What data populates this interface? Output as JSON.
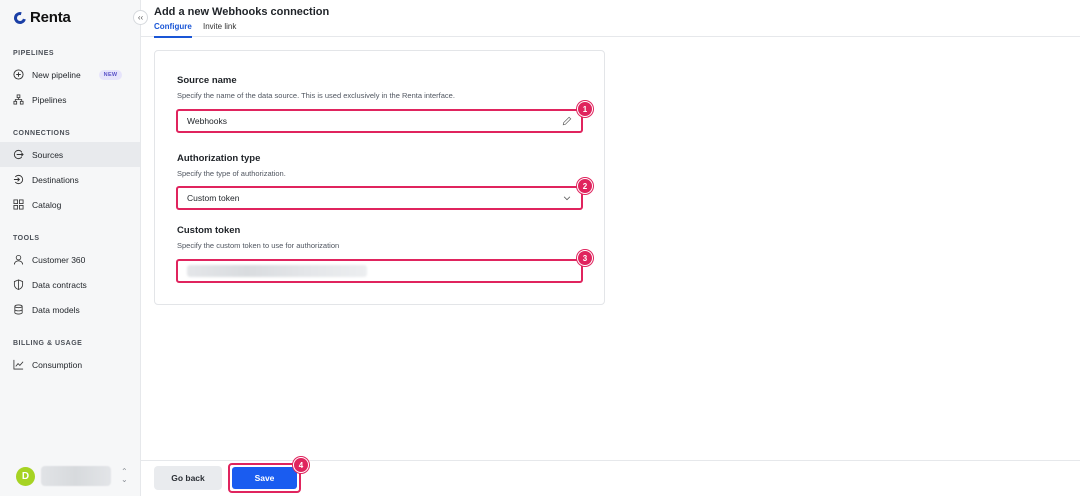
{
  "brand": {
    "name": "Renta"
  },
  "sidebar": {
    "sections": [
      {
        "title": "PIPELINES",
        "items": [
          {
            "label": "New pipeline",
            "icon": "plus-circle-icon",
            "badge": "NEW"
          },
          {
            "label": "Pipelines",
            "icon": "hierarchy-icon"
          }
        ]
      },
      {
        "title": "CONNECTIONS",
        "items": [
          {
            "label": "Sources",
            "icon": "source-icon",
            "active": true
          },
          {
            "label": "Destinations",
            "icon": "destination-icon"
          },
          {
            "label": "Catalog",
            "icon": "grid-icon"
          }
        ]
      },
      {
        "title": "TOOLS",
        "items": [
          {
            "label": "Customer 360",
            "icon": "user-icon"
          },
          {
            "label": "Data contracts",
            "icon": "shield-icon"
          },
          {
            "label": "Data models",
            "icon": "database-icon"
          }
        ]
      },
      {
        "title": "BILLING & USAGE",
        "items": [
          {
            "label": "Consumption",
            "icon": "chart-icon"
          }
        ]
      }
    ],
    "account": {
      "avatar_letter": "D"
    }
  },
  "header": {
    "title": "Add a new Webhooks connection",
    "tabs": [
      {
        "label": "Configure",
        "active": true
      },
      {
        "label": "Invite link"
      }
    ]
  },
  "form": {
    "source_name": {
      "label": "Source name",
      "help": "Specify the name of the data source. This is used exclusively in the Renta interface.",
      "value": "Webhooks",
      "marker": "1"
    },
    "authorization_type": {
      "label": "Authorization type",
      "help": "Specify the type of authorization.",
      "value": "Custom token",
      "marker": "2"
    },
    "custom_token": {
      "label": "Custom token",
      "help": "Specify the custom token to use for authorization",
      "marker": "3"
    }
  },
  "footer": {
    "back_label": "Go back",
    "save_label": "Save",
    "save_marker": "4"
  },
  "colors": {
    "accent": "#1a5cf0",
    "highlight": "#e0245e",
    "avatar": "#a6d323"
  }
}
